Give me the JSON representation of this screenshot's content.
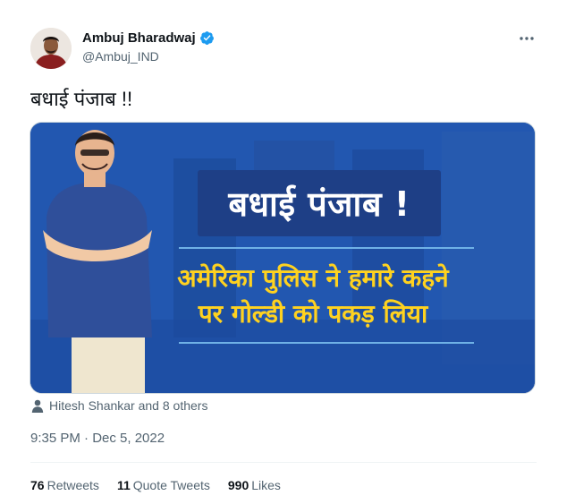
{
  "author": {
    "name": "Ambuj Bharadwaj",
    "handle": "@Ambuj_IND",
    "verified": true
  },
  "more_icon": "more-horizontal-icon",
  "tweet_text": "बधाई पंजाब !!",
  "media": {
    "title": "बधाई पंजाब !",
    "line1": "अमेरिका पुलिस ने हमारे कहने",
    "line2": "पर गोल्डी को पकड़ लिया"
  },
  "tagged": "Hitesh Shankar and 8 others",
  "timestamp": "9:35 PM · Dec 5, 2022",
  "stats": {
    "retweets_count": "76",
    "retweets_label": "Retweets",
    "quote_count": "11",
    "quote_label": "Quote Tweets",
    "likes_count": "990",
    "likes_label": "Likes"
  },
  "colors": {
    "verified_badge": "#1d9bf0",
    "media_bg": "#1d4ea8",
    "media_subtitle": "#ffd21f",
    "secondary_text": "#536471"
  }
}
